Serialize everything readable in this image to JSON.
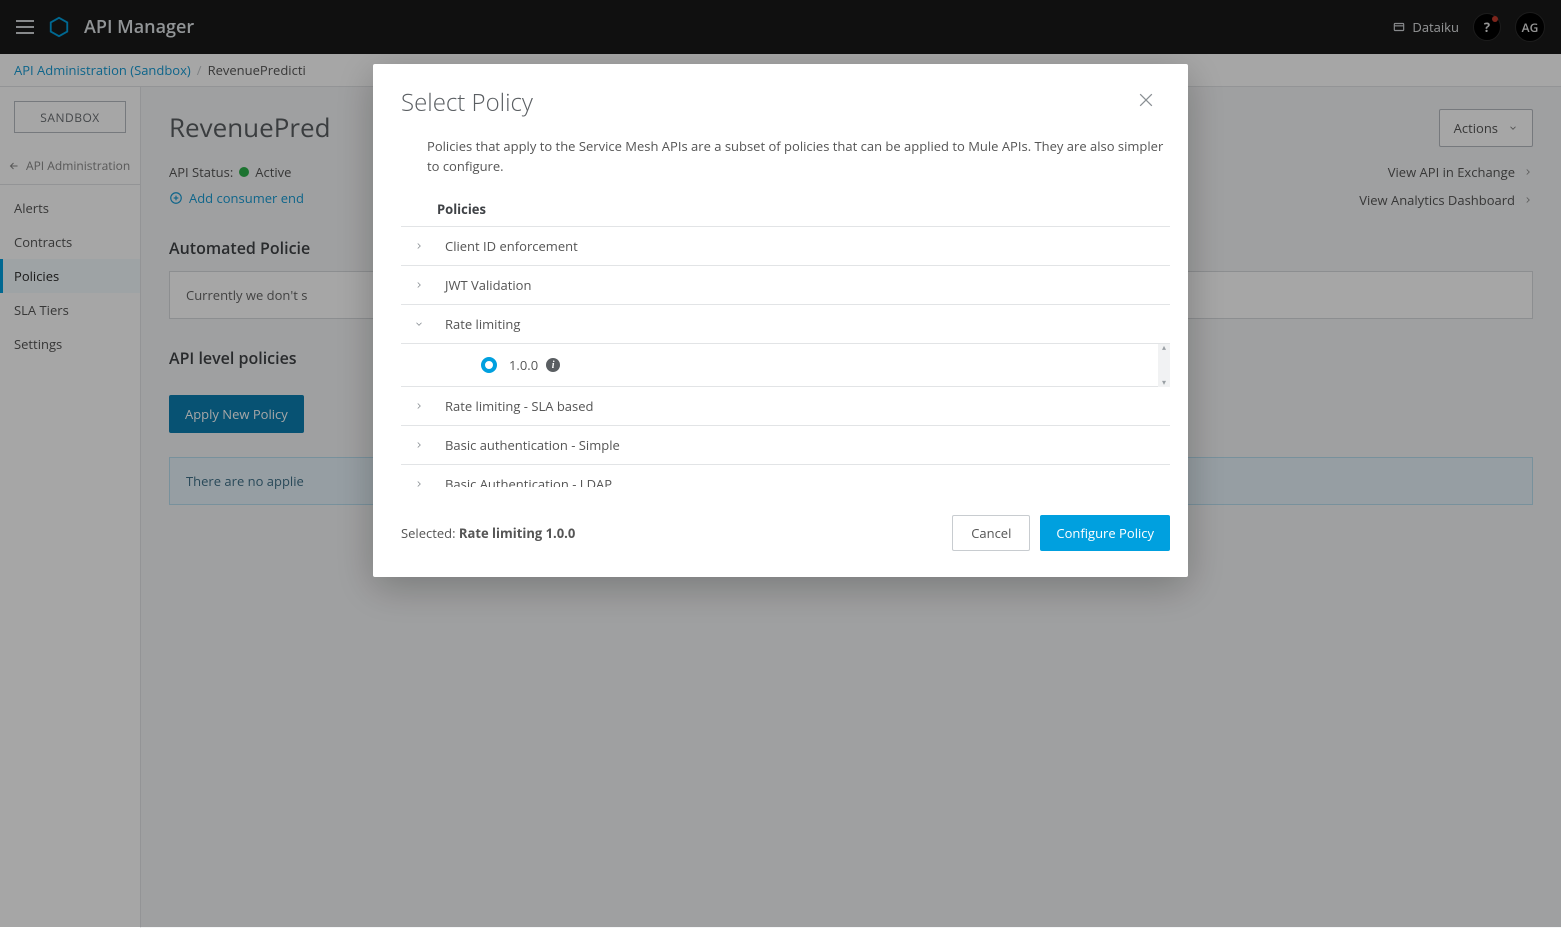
{
  "header": {
    "app_title": "API Manager",
    "ext_link_label": "Dataiku",
    "help_glyph": "?",
    "avatar_initials": "AG"
  },
  "breadcrumb": {
    "root": "API Administration (Sandbox)",
    "current_truncated": "RevenuePredicti"
  },
  "sidebar": {
    "env_label": "SANDBOX",
    "back_label": "API Administration",
    "items": [
      {
        "label": "Alerts"
      },
      {
        "label": "Contracts"
      },
      {
        "label": "Policies",
        "active": true
      },
      {
        "label": "SLA Tiers"
      },
      {
        "label": "Settings"
      }
    ]
  },
  "page": {
    "title_truncated": "RevenuePred",
    "actions_label": "Actions",
    "status_label": "API Status:",
    "status_value": "Active",
    "add_consumer_label": "Add consumer end",
    "view_exchange": "View API in Exchange",
    "view_dashboard": "View Analytics Dashboard",
    "automated_section": "Automated Policie",
    "automated_panel_text": "Currently we don't s",
    "api_level_section": "API level policies",
    "apply_btn": "Apply New Policy",
    "empty_info": "There are no applie"
  },
  "modal": {
    "title": "Select Policy",
    "description": "Policies that apply to the Service Mesh APIs are a subset of policies that can be applied to Mule APIs. They are also simpler to configure.",
    "list_header": "Policies",
    "items": [
      {
        "name": "Client ID enforcement",
        "expanded": false
      },
      {
        "name": "JWT Validation",
        "expanded": false
      },
      {
        "name": "Rate limiting",
        "expanded": true,
        "versions": [
          {
            "label": "1.0.0",
            "selected": true
          }
        ]
      },
      {
        "name": "Rate limiting - SLA based",
        "expanded": false
      },
      {
        "name": "Basic authentication - Simple",
        "expanded": false
      },
      {
        "name": "Basic Authentication - LDAP",
        "expanded": false
      }
    ],
    "selected_prefix": "Selected: ",
    "selected_value": "Rate limiting 1.0.0",
    "cancel": "Cancel",
    "configure": "Configure Policy"
  }
}
